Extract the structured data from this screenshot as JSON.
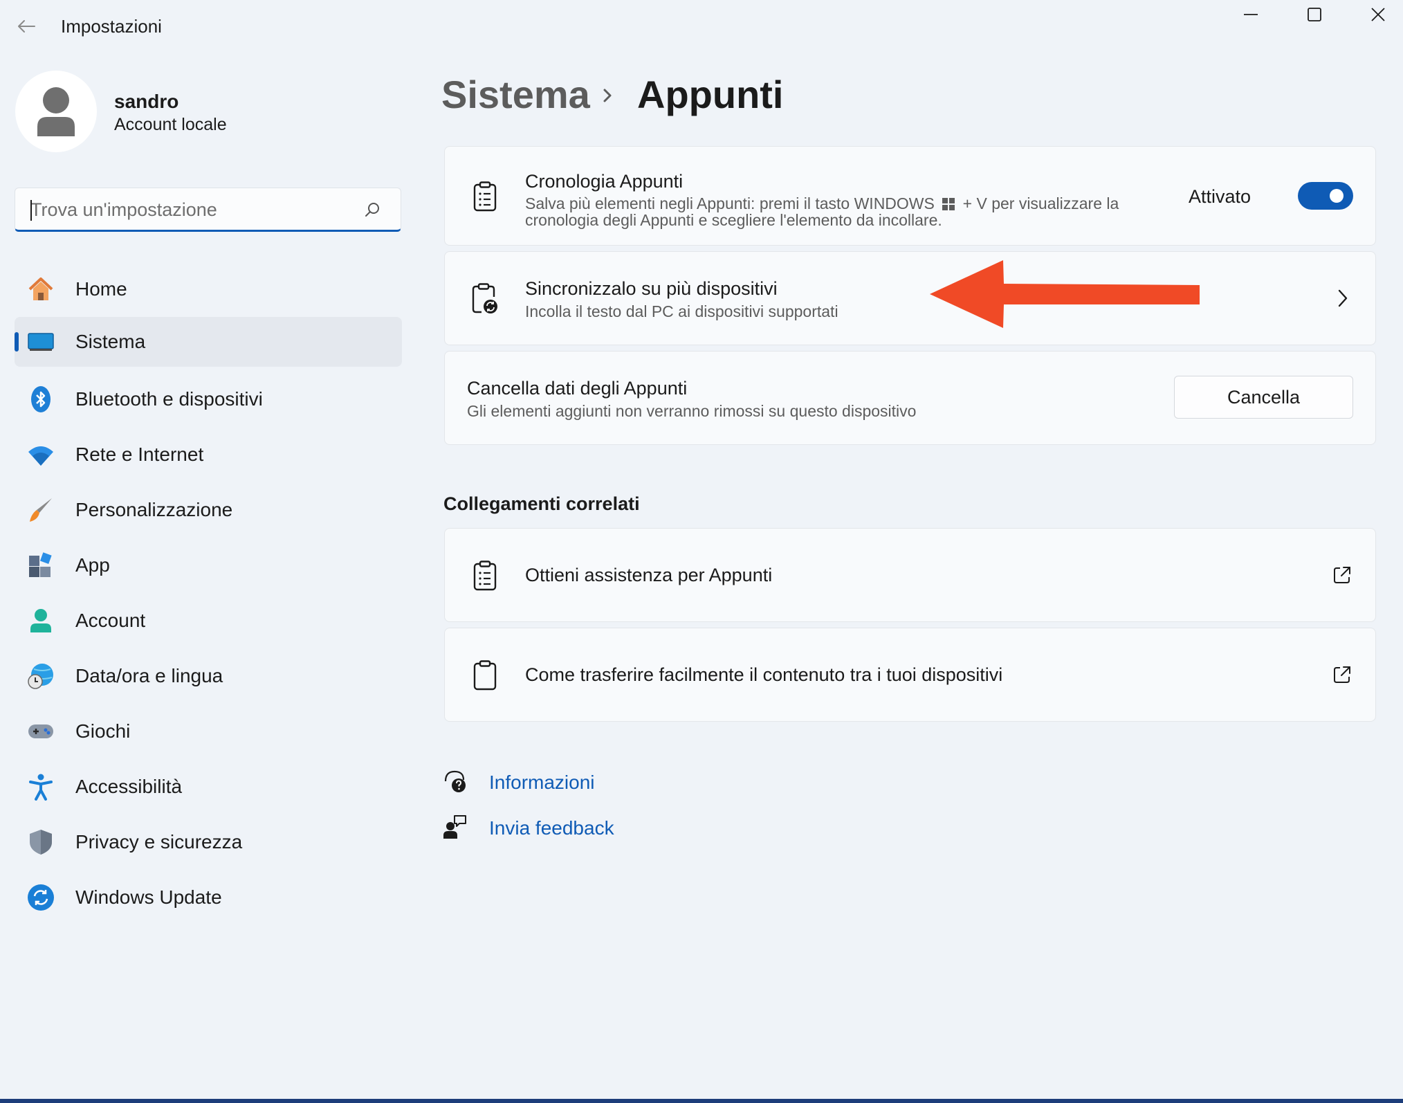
{
  "window": {
    "title": "Impostazioni"
  },
  "profile": {
    "name": "sandro",
    "account_type": "Account locale"
  },
  "search": {
    "placeholder": "Trova un'impostazione",
    "value": ""
  },
  "nav": {
    "items": [
      {
        "label": "Home",
        "icon": "home-icon",
        "selected": false
      },
      {
        "label": "Sistema",
        "icon": "system-icon",
        "selected": true
      },
      {
        "label": "Bluetooth e dispositivi",
        "icon": "bluetooth-icon",
        "selected": false
      },
      {
        "label": "Rete e Internet",
        "icon": "wifi-icon",
        "selected": false
      },
      {
        "label": "Personalizzazione",
        "icon": "brush-icon",
        "selected": false
      },
      {
        "label": "App",
        "icon": "apps-icon",
        "selected": false
      },
      {
        "label": "Account",
        "icon": "account-icon",
        "selected": false
      },
      {
        "label": "Data/ora e lingua",
        "icon": "time-language-icon",
        "selected": false
      },
      {
        "label": "Giochi",
        "icon": "gamepad-icon",
        "selected": false
      },
      {
        "label": "Accessibilità",
        "icon": "accessibility-icon",
        "selected": false
      },
      {
        "label": "Privacy e sicurezza",
        "icon": "shield-icon",
        "selected": false
      },
      {
        "label": "Windows Update",
        "icon": "update-icon",
        "selected": false
      }
    ]
  },
  "breadcrumb": {
    "parent": "Sistema",
    "separator": "›",
    "current": "Appunti"
  },
  "history_card": {
    "title": "Cronologia Appunti",
    "description_line1": "Salva più elementi negli Appunti: premi il tasto WINDOWS",
    "description_line1_end": "+ V per visualizzare la",
    "description_line2": "cronologia degli Appunti e scegliere l'elemento da incollare.",
    "toggle_label": "Attivato",
    "toggle_on": true
  },
  "sync_card": {
    "title": "Sincronizzalo su più dispositivi",
    "description": "Incolla il testo dal PC ai dispositivi supportati"
  },
  "clear_card": {
    "title": "Cancella dati degli Appunti",
    "description": "Gli elementi aggiunti non verranno rimossi su questo dispositivo",
    "button_label": "Cancella"
  },
  "related": {
    "section_title": "Collegamenti correlati",
    "links": [
      {
        "label": "Ottieni assistenza per Appunti"
      },
      {
        "label": "Come trasferire facilmente il contenuto tra i tuoi dispositivi"
      }
    ]
  },
  "footer": {
    "info_label": "Informazioni",
    "feedback_label": "Invia feedback"
  },
  "colors": {
    "accent": "#0f5bb5",
    "annotation_arrow": "#f04a26",
    "background": "#eff3f8"
  }
}
